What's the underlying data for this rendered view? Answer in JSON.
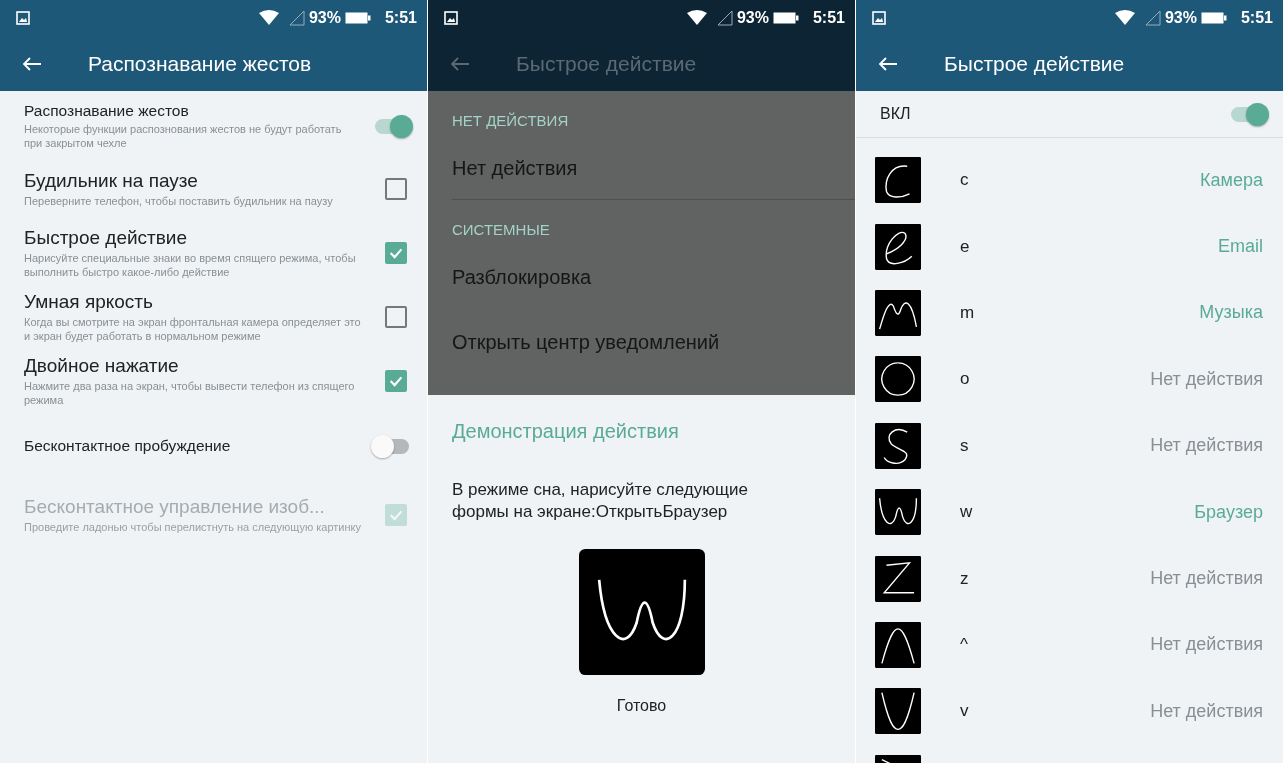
{
  "screens": [
    {
      "status_bar": {
        "battery": "93%",
        "time": "5:51"
      },
      "header": {
        "title": "Распознавание жестов",
        "dimmed": false
      },
      "settings": [
        {
          "kind": "toggle",
          "title": "Распознавание жестов",
          "subtitle": "Некоторые функции распознования жестов не будут работать при закрытом чехле",
          "on": true,
          "disabled": false
        },
        {
          "kind": "checkbox",
          "title": "Будильник на паузе",
          "subtitle": "Переверните телефон, чтобы поставить будильник на паузу",
          "on": false,
          "disabled": false
        },
        {
          "kind": "checkbox",
          "title": "Быстрое действие",
          "subtitle": "Нарисуйте специальные знаки во время спящего режима, чтобы выполнить быстро какое-либо действие",
          "on": true,
          "disabled": false
        },
        {
          "kind": "checkbox",
          "title": "Умная яркость",
          "subtitle": "Когда вы смотрите на экран фронтальная камера определяет это и экран будет работать в нормальном режиме",
          "on": false,
          "disabled": false
        },
        {
          "kind": "checkbox",
          "title": "Двойное нажатие",
          "subtitle": "Нажмите два раза на экран, чтобы вывести телефон из спящего режима",
          "on": true,
          "disabled": false
        },
        {
          "kind": "toggle",
          "title": "Бесконтактное пробуждение",
          "on": false,
          "disabled": false
        },
        {
          "kind": "checkbox",
          "title": "Бесконтактное управление изоб...",
          "subtitle": "Проведите ладонью чтобы перелистнуть на следующую картинку",
          "on": true,
          "disabled": true
        }
      ]
    },
    {
      "status_bar": {
        "battery": "93%",
        "time": "5:51"
      },
      "header": {
        "title": "Быстрое действие",
        "dimmed": true
      },
      "menu": [
        {
          "header": "НЕТ ДЕЙСТВИЯ",
          "items": [
            "Нет действия"
          ]
        },
        {
          "header": "СИСТЕМНЫЕ",
          "items": [
            "Разблокировка",
            "Открыть центр уведомлений"
          ]
        }
      ],
      "demo": {
        "title": "Демонстрация действия",
        "text": "В режиме сна, нарисуйте следующие формы на экране:ОткрытьБраузер",
        "kind": "w",
        "button": "Готово"
      }
    },
    {
      "status_bar": {
        "battery": "93%",
        "time": "5:51"
      },
      "header": {
        "title": "Быстрое действие",
        "dimmed": false
      },
      "master": {
        "label": "ВКЛ",
        "on": true
      },
      "gestures": [
        {
          "kind": "c",
          "letter": "c",
          "action": "Камера",
          "assigned": true
        },
        {
          "kind": "e",
          "letter": "e",
          "action": "Email",
          "assigned": true
        },
        {
          "kind": "m",
          "letter": "m",
          "action": "Музыка",
          "assigned": true
        },
        {
          "kind": "o",
          "letter": "o",
          "action": "Нет действия",
          "assigned": false
        },
        {
          "kind": "s",
          "letter": "s",
          "action": "Нет действия",
          "assigned": false
        },
        {
          "kind": "w",
          "letter": "w",
          "action": "Браузер",
          "assigned": true
        },
        {
          "kind": "z",
          "letter": "z",
          "action": "Нет действия",
          "assigned": false
        },
        {
          "kind": "caret",
          "letter": "^",
          "action": "Нет действия",
          "assigned": false
        },
        {
          "kind": "v",
          "letter": "v",
          "action": "Нет действия",
          "assigned": false
        },
        {
          "kind": "diagonal"
        }
      ]
    }
  ]
}
